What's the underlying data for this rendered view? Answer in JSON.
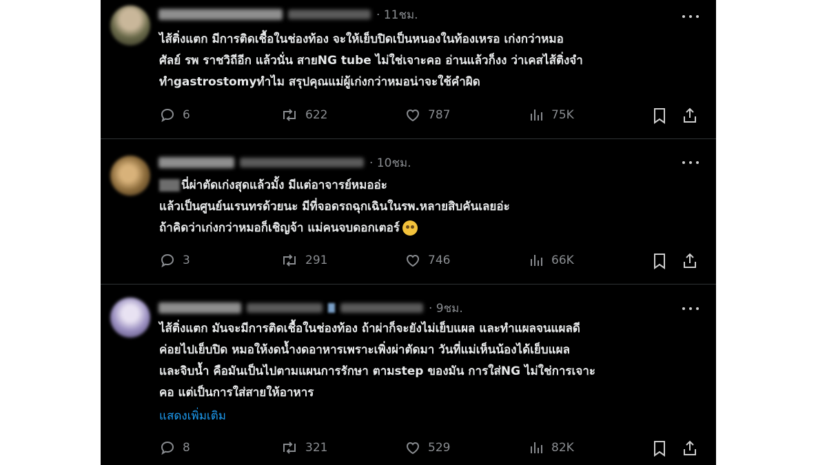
{
  "posts": [
    {
      "time": "· 11ชม.",
      "text": "ไส้ติ่งแตก มีการติดเชื้อในช่องท้อง จะให้เย็บปิดเป็นหนองในท้องเหรอ เก่งกว่าหมอ\nศัลย์ รพ ราชวิถีอีก แล้วนั่น สายNG tube ไม่ใช่เจาะคอ อ่านแล้วก็งง ว่าเคสไส้ติ่งจำ\nทำgastrostomyทำไม สรุปคุณแม่ผู้เก่งกว่าหมอน่าจะใช้คำผิด",
      "replies": "6",
      "reposts": "622",
      "likes": "787",
      "views": "75K"
    },
    {
      "time": "· 10ชม.",
      "text_line1_suffix": "นี่ผ่าตัดเก่งสุดแล้วมั้ง มีแต่อาจารย์หมออ่ะ",
      "text_rest": "แล้วเป็นศูนย์นเรนทรด้วยนะ มีที่จอดรถฉุกเฉินในรพ.หลายสิบคันเลยอ่ะ\nถ้าคิดว่าเก่งกว่าหมอก็เชิญจ้า แม่คนจบดอกเตอร์",
      "emoji": "rolling-eyes-emoji",
      "replies": "3",
      "reposts": "291",
      "likes": "746",
      "views": "66K"
    },
    {
      "time": "· 9ชม.",
      "text": "ไส้ติ่งแตก มันจะมีการติดเชื้อในช่องท้อง ถ้าผ่าก็จะยังไม่เย็บแผล และทำแผลจนแผลดี\nค่อยไปเย็บปิด หมอให้งดน้ำงดอาหารเพราะเพิ่งผ่าตัดมา วันที่แม่เห็นน้องได้เย็บแผล\nและจิบน้ำ คือมันเป็นไปตามแผนการรักษา ตามstep ของมัน การใส่NG ไม่ใช่การเจาะ\nคอ แต่เป็นการใส่สายให้อาหาร",
      "show_more": "แสดงเพิ่มเติม",
      "replies": "8",
      "reposts": "321",
      "likes": "529",
      "views": "82K"
    }
  ],
  "colors": {
    "background": "#000000",
    "text": "#e7e9ea",
    "muted": "#8a8d91",
    "link": "#1d9bf0",
    "divider": "#2f3336"
  },
  "icons": [
    "reply-icon",
    "repost-icon",
    "like-icon",
    "views-icon",
    "bookmark-icon",
    "share-icon",
    "more-icon"
  ]
}
